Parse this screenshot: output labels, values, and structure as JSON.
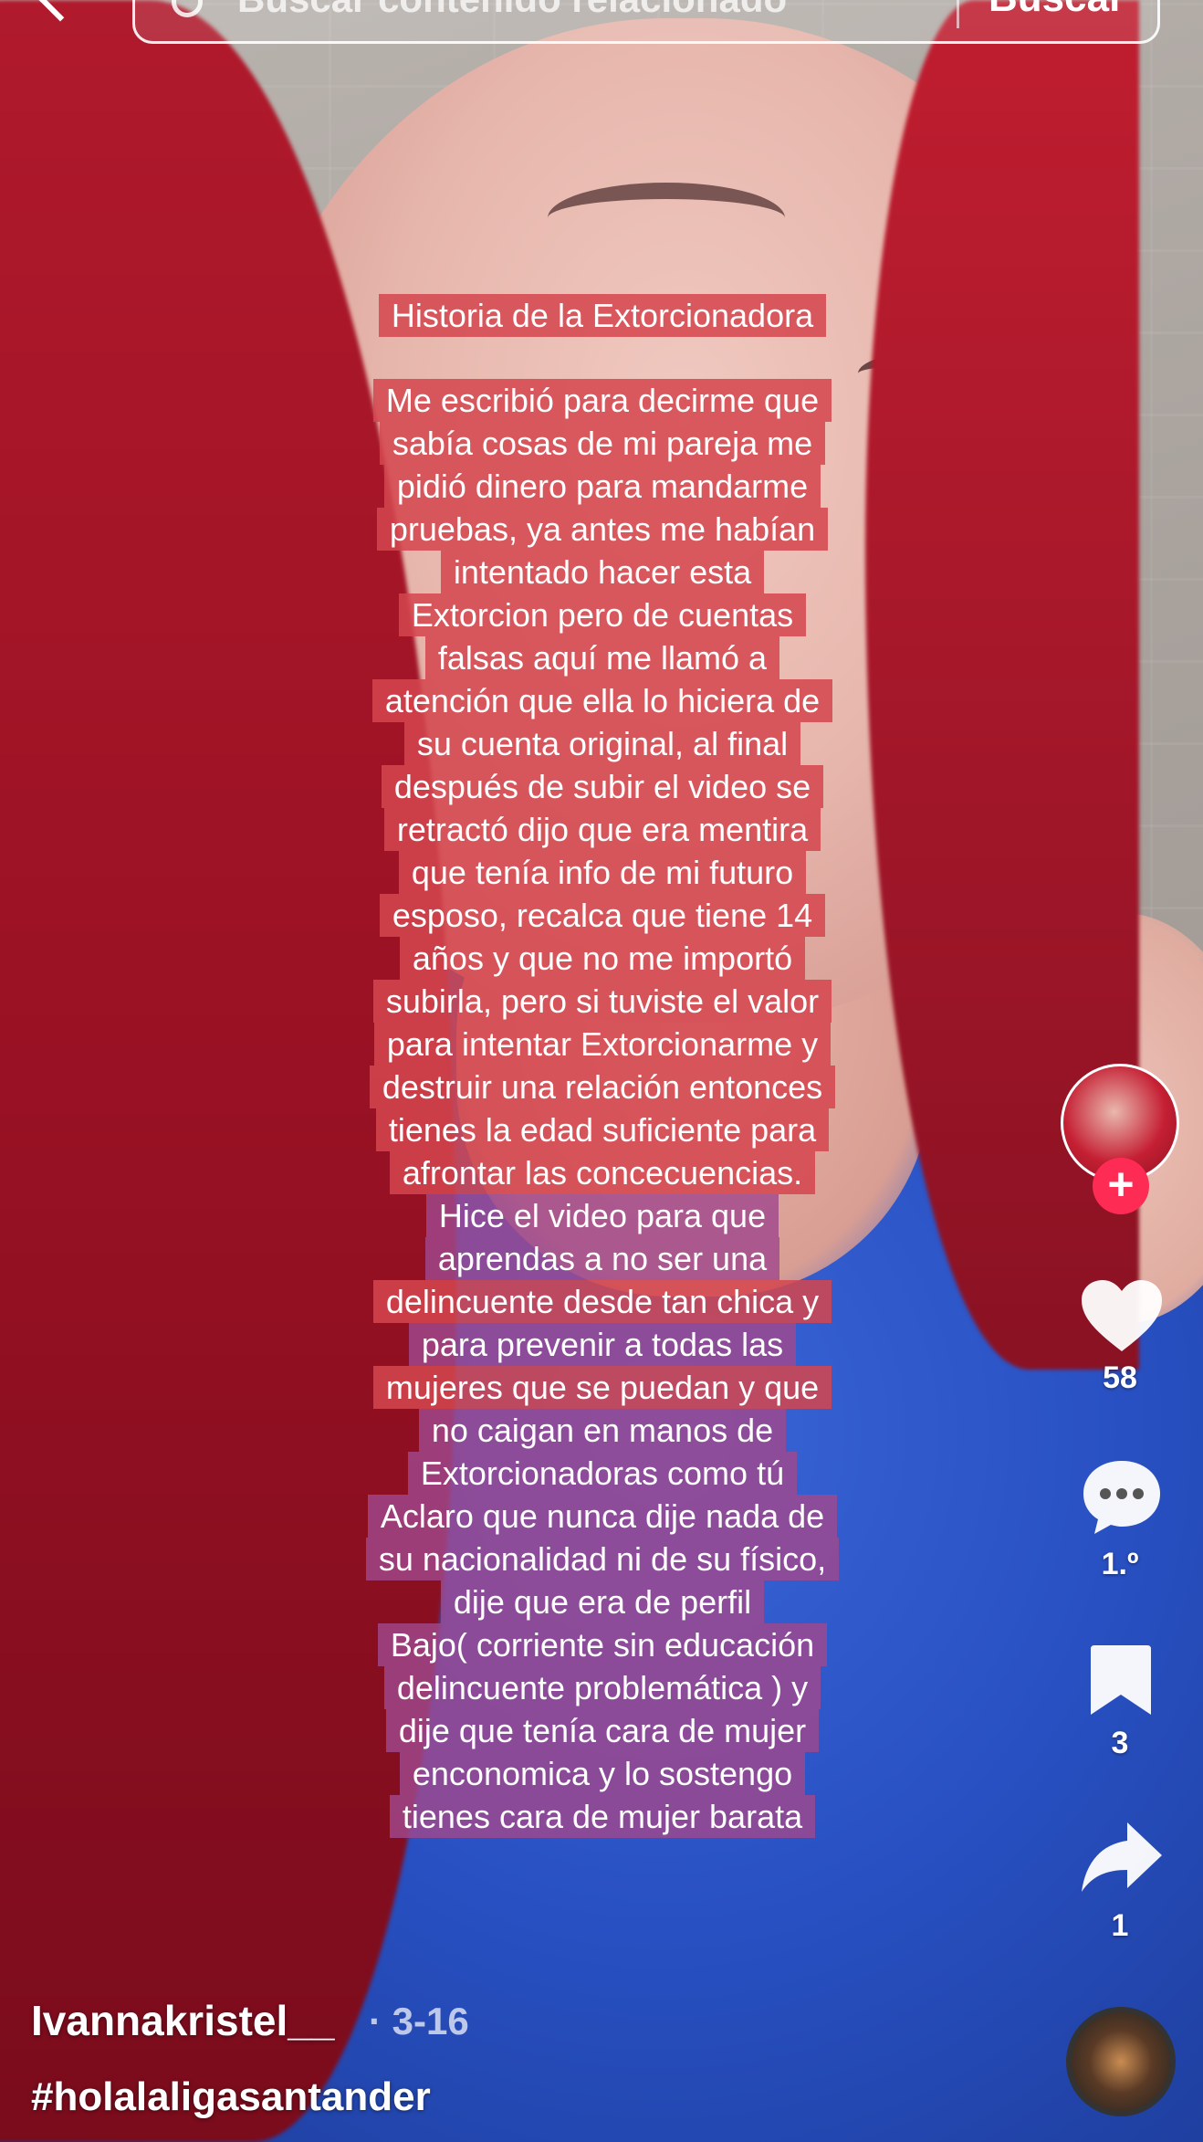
{
  "search": {
    "placeholder": "Buscar contenido relacionado",
    "button_label": "Buscar"
  },
  "caption": {
    "title": "Historia de la Extorcionadora",
    "lines": [
      "Me escribió para decirme que",
      "sabía cosas de mi pareja me",
      "pidió dinero para mandarme",
      "pruebas, ya antes me habían",
      "intentado hacer esta",
      "Extorcion pero de cuentas",
      "falsas aquí me llamó a",
      "atención que ella lo hiciera de",
      "su cuenta original, al final",
      "después de subir el video se",
      "retractó dijo que era mentira",
      "que tenía info de mi futuro",
      "esposo, recalca que tiene 14",
      "años y que no me importó",
      "subirla, pero si tuviste el valor",
      "para intentar Extorcionarme y",
      "destruir una relación entonces",
      "tienes la edad suficiente para",
      "afrontar las concecuencias.",
      "Hice el video para que",
      "aprendas a no ser una",
      "delincuente desde tan chica y",
      "para prevenir a todas las",
      "mujeres que se puedan y que",
      "no caigan en manos de",
      "Extorcionadoras como tú",
      "Aclaro que nunca dije nada de",
      "su nacionalidad ni de su físico,",
      "dije que era de perfil",
      "Bajo( corriente sin educación",
      "delincuente problemática ) y",
      "dije que tenía cara de mujer",
      "enconomica y lo sostengo",
      "tienes cara de mujer barata"
    ]
  },
  "actions": {
    "likes": "58",
    "comments": "1.º",
    "saves": "3",
    "shares": "1",
    "follow_icon": "plus-icon"
  },
  "post": {
    "username": "Ivannakristel__",
    "date": "· 3-16",
    "hashtag": "#holalaligasantander"
  },
  "colors": {
    "caption_bg": "#d4464e",
    "follow_accent": "#fe2c55"
  }
}
